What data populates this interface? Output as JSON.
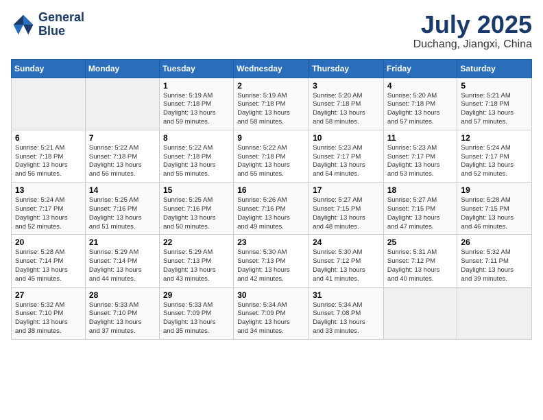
{
  "logo": {
    "line1": "General",
    "line2": "Blue"
  },
  "title": "July 2025",
  "location": "Duchang, Jiangxi, China",
  "days_of_week": [
    "Sunday",
    "Monday",
    "Tuesday",
    "Wednesday",
    "Thursday",
    "Friday",
    "Saturday"
  ],
  "weeks": [
    [
      {
        "day": "",
        "info": ""
      },
      {
        "day": "",
        "info": ""
      },
      {
        "day": "1",
        "info": "Sunrise: 5:19 AM\nSunset: 7:18 PM\nDaylight: 13 hours\nand 59 minutes."
      },
      {
        "day": "2",
        "info": "Sunrise: 5:19 AM\nSunset: 7:18 PM\nDaylight: 13 hours\nand 58 minutes."
      },
      {
        "day": "3",
        "info": "Sunrise: 5:20 AM\nSunset: 7:18 PM\nDaylight: 13 hours\nand 58 minutes."
      },
      {
        "day": "4",
        "info": "Sunrise: 5:20 AM\nSunset: 7:18 PM\nDaylight: 13 hours\nand 57 minutes."
      },
      {
        "day": "5",
        "info": "Sunrise: 5:21 AM\nSunset: 7:18 PM\nDaylight: 13 hours\nand 57 minutes."
      }
    ],
    [
      {
        "day": "6",
        "info": "Sunrise: 5:21 AM\nSunset: 7:18 PM\nDaylight: 13 hours\nand 56 minutes."
      },
      {
        "day": "7",
        "info": "Sunrise: 5:22 AM\nSunset: 7:18 PM\nDaylight: 13 hours\nand 56 minutes."
      },
      {
        "day": "8",
        "info": "Sunrise: 5:22 AM\nSunset: 7:18 PM\nDaylight: 13 hours\nand 55 minutes."
      },
      {
        "day": "9",
        "info": "Sunrise: 5:22 AM\nSunset: 7:18 PM\nDaylight: 13 hours\nand 55 minutes."
      },
      {
        "day": "10",
        "info": "Sunrise: 5:23 AM\nSunset: 7:17 PM\nDaylight: 13 hours\nand 54 minutes."
      },
      {
        "day": "11",
        "info": "Sunrise: 5:23 AM\nSunset: 7:17 PM\nDaylight: 13 hours\nand 53 minutes."
      },
      {
        "day": "12",
        "info": "Sunrise: 5:24 AM\nSunset: 7:17 PM\nDaylight: 13 hours\nand 52 minutes."
      }
    ],
    [
      {
        "day": "13",
        "info": "Sunrise: 5:24 AM\nSunset: 7:17 PM\nDaylight: 13 hours\nand 52 minutes."
      },
      {
        "day": "14",
        "info": "Sunrise: 5:25 AM\nSunset: 7:16 PM\nDaylight: 13 hours\nand 51 minutes."
      },
      {
        "day": "15",
        "info": "Sunrise: 5:25 AM\nSunset: 7:16 PM\nDaylight: 13 hours\nand 50 minutes."
      },
      {
        "day": "16",
        "info": "Sunrise: 5:26 AM\nSunset: 7:16 PM\nDaylight: 13 hours\nand 49 minutes."
      },
      {
        "day": "17",
        "info": "Sunrise: 5:27 AM\nSunset: 7:15 PM\nDaylight: 13 hours\nand 48 minutes."
      },
      {
        "day": "18",
        "info": "Sunrise: 5:27 AM\nSunset: 7:15 PM\nDaylight: 13 hours\nand 47 minutes."
      },
      {
        "day": "19",
        "info": "Sunrise: 5:28 AM\nSunset: 7:15 PM\nDaylight: 13 hours\nand 46 minutes."
      }
    ],
    [
      {
        "day": "20",
        "info": "Sunrise: 5:28 AM\nSunset: 7:14 PM\nDaylight: 13 hours\nand 45 minutes."
      },
      {
        "day": "21",
        "info": "Sunrise: 5:29 AM\nSunset: 7:14 PM\nDaylight: 13 hours\nand 44 minutes."
      },
      {
        "day": "22",
        "info": "Sunrise: 5:29 AM\nSunset: 7:13 PM\nDaylight: 13 hours\nand 43 minutes."
      },
      {
        "day": "23",
        "info": "Sunrise: 5:30 AM\nSunset: 7:13 PM\nDaylight: 13 hours\nand 42 minutes."
      },
      {
        "day": "24",
        "info": "Sunrise: 5:30 AM\nSunset: 7:12 PM\nDaylight: 13 hours\nand 41 minutes."
      },
      {
        "day": "25",
        "info": "Sunrise: 5:31 AM\nSunset: 7:12 PM\nDaylight: 13 hours\nand 40 minutes."
      },
      {
        "day": "26",
        "info": "Sunrise: 5:32 AM\nSunset: 7:11 PM\nDaylight: 13 hours\nand 39 minutes."
      }
    ],
    [
      {
        "day": "27",
        "info": "Sunrise: 5:32 AM\nSunset: 7:10 PM\nDaylight: 13 hours\nand 38 minutes."
      },
      {
        "day": "28",
        "info": "Sunrise: 5:33 AM\nSunset: 7:10 PM\nDaylight: 13 hours\nand 37 minutes."
      },
      {
        "day": "29",
        "info": "Sunrise: 5:33 AM\nSunset: 7:09 PM\nDaylight: 13 hours\nand 35 minutes."
      },
      {
        "day": "30",
        "info": "Sunrise: 5:34 AM\nSunset: 7:09 PM\nDaylight: 13 hours\nand 34 minutes."
      },
      {
        "day": "31",
        "info": "Sunrise: 5:34 AM\nSunset: 7:08 PM\nDaylight: 13 hours\nand 33 minutes."
      },
      {
        "day": "",
        "info": ""
      },
      {
        "day": "",
        "info": ""
      }
    ]
  ]
}
